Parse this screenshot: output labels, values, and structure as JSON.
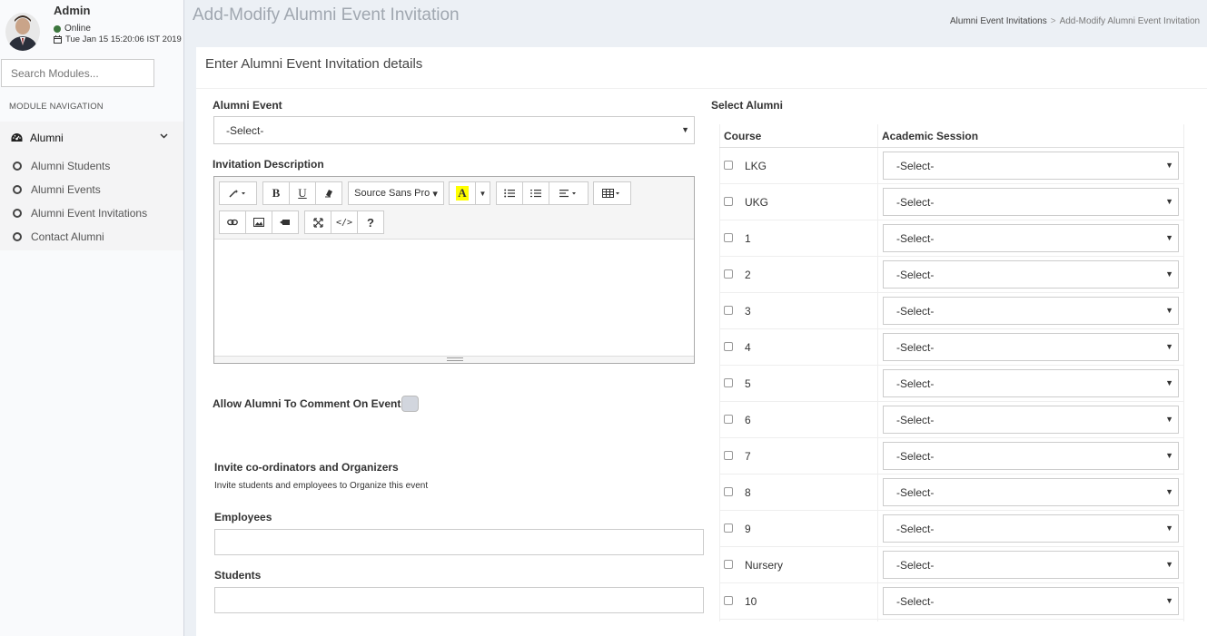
{
  "user": {
    "name": "Admin",
    "status": "Online",
    "datetime": "Tue Jan 15 15:20:06 IST 2019"
  },
  "sidebar": {
    "search_placeholder": "Search Modules...",
    "nav_header": "MODULE NAVIGATION",
    "parent": "Alumni",
    "items": [
      {
        "label": "Alumni Students"
      },
      {
        "label": "Alumni Events"
      },
      {
        "label": "Alumni Event Invitations"
      },
      {
        "label": "Contact Alumni"
      }
    ]
  },
  "header": {
    "title": "Add-Modify Alumni Event Invitation",
    "breadcrumb": [
      "Alumni Event Invitations",
      "Add-Modify Alumni Event Invitation"
    ]
  },
  "form": {
    "box_title": "Enter Alumni Event Invitation details",
    "alumni_event_label": "Alumni Event",
    "alumni_event_value": "-Select-",
    "invitation_description_label": "Invitation Description",
    "font_name": "Source Sans Pro",
    "allow_comment_label": "Allow Alumni To Comment On Event",
    "invite_heading": "Invite co-ordinators and Organizers",
    "invite_help": "Invite students and employees to Organize this event",
    "employees_label": "Employees",
    "students_label": "Students"
  },
  "alumni_table": {
    "title": "Select Alumni",
    "col_course": "Course",
    "col_session": "Academic Session",
    "rows": [
      {
        "course": "LKG",
        "session": "-Select-"
      },
      {
        "course": "UKG",
        "session": "-Select-"
      },
      {
        "course": "1",
        "session": "-Select-"
      },
      {
        "course": "2",
        "session": "-Select-"
      },
      {
        "course": "3",
        "session": "-Select-"
      },
      {
        "course": "4",
        "session": "-Select-"
      },
      {
        "course": "5",
        "session": "-Select-"
      },
      {
        "course": "6",
        "session": "-Select-"
      },
      {
        "course": "7",
        "session": "-Select-"
      },
      {
        "course": "8",
        "session": "-Select-"
      },
      {
        "course": "9",
        "session": "-Select-"
      },
      {
        "course": "Nursery",
        "session": "-Select-"
      },
      {
        "course": "10",
        "session": "-Select-"
      }
    ]
  }
}
